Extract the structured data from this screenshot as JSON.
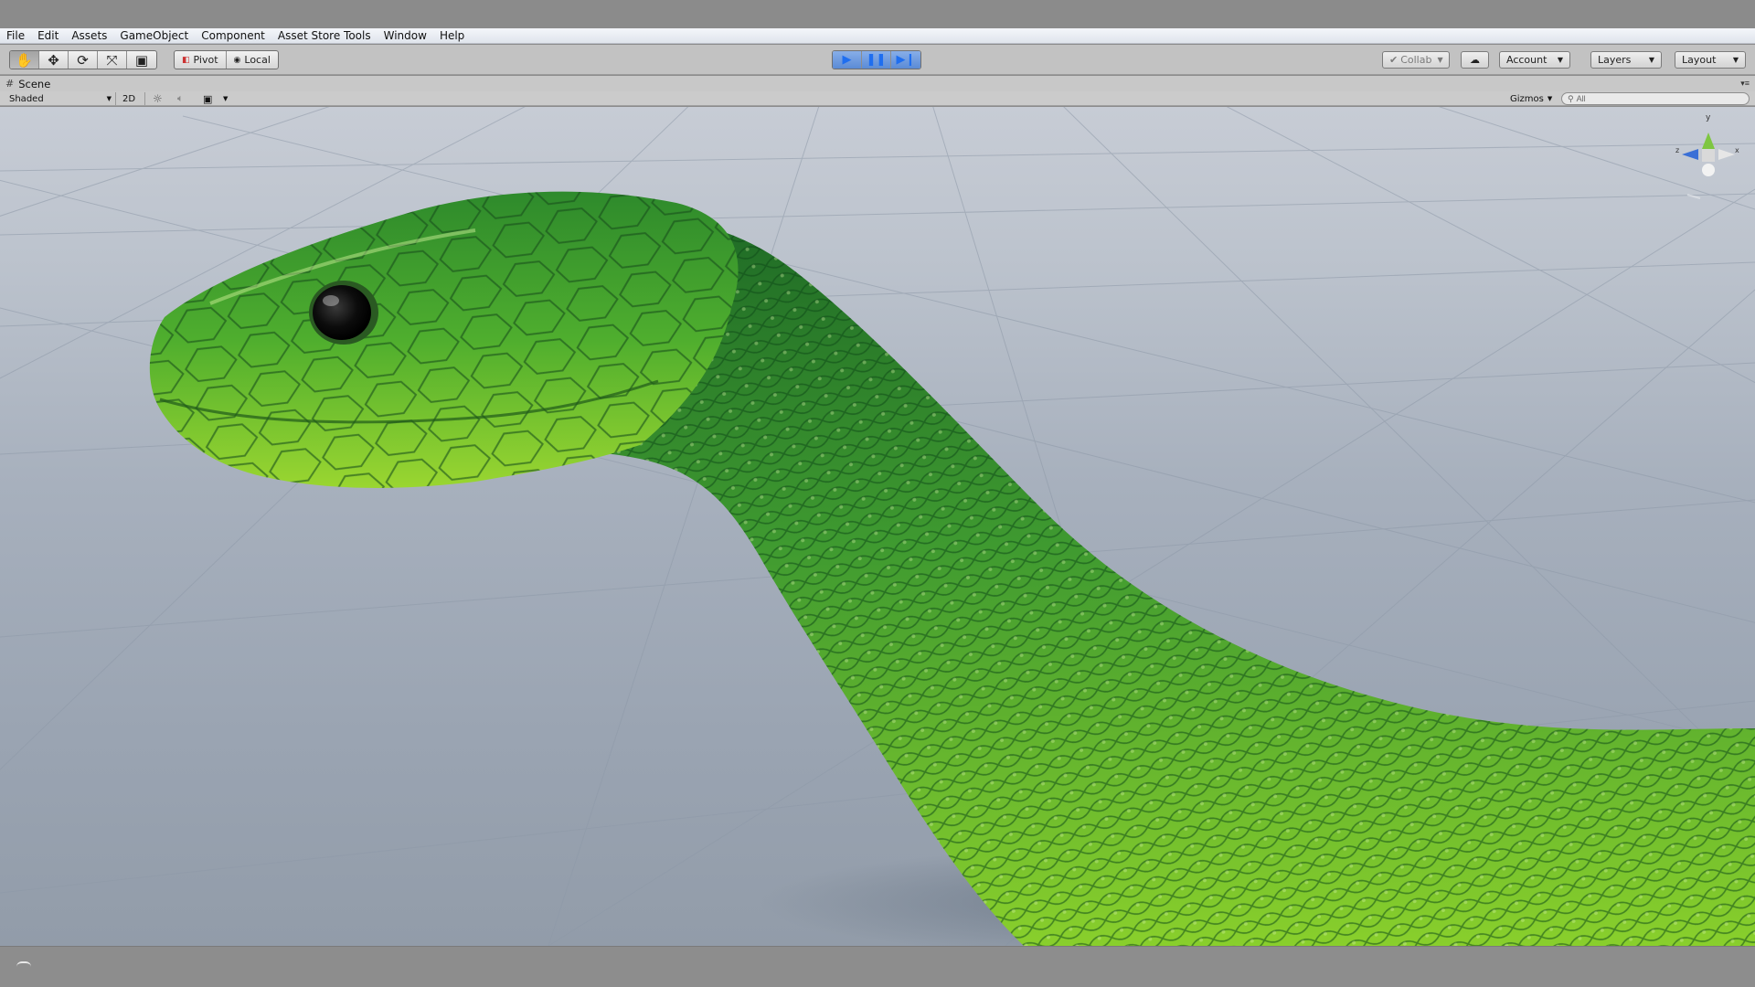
{
  "menu": {
    "items": [
      "File",
      "Edit",
      "Assets",
      "GameObject",
      "Component",
      "Asset Store Tools",
      "Window",
      "Help"
    ]
  },
  "toolbar": {
    "transform_tools": [
      {
        "name": "hand-tool",
        "glyph": "✋"
      },
      {
        "name": "move-tool",
        "glyph": "✥"
      },
      {
        "name": "rotate-tool",
        "glyph": "⟳"
      },
      {
        "name": "scale-tool",
        "glyph": "⤧"
      },
      {
        "name": "rect-tool",
        "glyph": "▣"
      }
    ],
    "pivot_label": "Pivot",
    "local_label": "Local",
    "collab_label": "Collab",
    "account_label": "Account",
    "layers_label": "Layers",
    "layout_label": "Layout"
  },
  "scene": {
    "tab_label": "Scene",
    "shading_mode": "Shaded",
    "mode_2d_label": "2D",
    "gizmos_label": "Gizmos",
    "search_placeholder": "All"
  },
  "colors": {
    "snake_dark": "#1e6b24",
    "snake_mid": "#3f9d2e",
    "snake_light": "#8ed12a",
    "play_accent": "#1e6ef0"
  },
  "gizmo_axes": {
    "y_label": "y",
    "x_label": "x",
    "z_label": "z"
  }
}
